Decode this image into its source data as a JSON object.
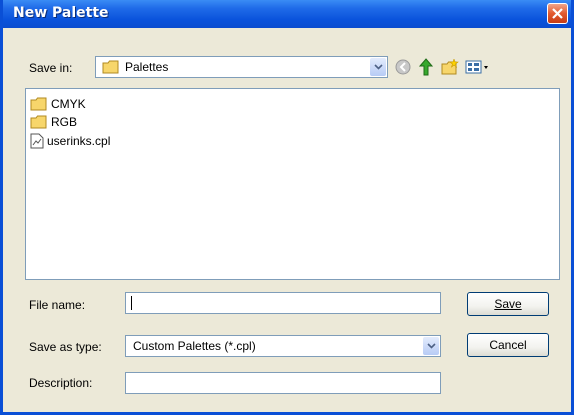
{
  "window": {
    "title": "New Palette"
  },
  "toolbar": {
    "save_in_label": "Save in:",
    "save_in_value": "Palettes",
    "icons": [
      "back-icon",
      "up-folder-icon",
      "new-folder-icon",
      "views-menu-icon"
    ]
  },
  "files": [
    {
      "name": "CMYK",
      "icon": "folder-icon"
    },
    {
      "name": "RGB",
      "icon": "folder-icon"
    },
    {
      "name": "userinks.cpl",
      "icon": "palette-file-icon"
    }
  ],
  "form": {
    "file_name_label": "File name:",
    "file_name_value": "",
    "save_type_label": "Save as type:",
    "save_type_value": "Custom Palettes (*.cpl)",
    "description_label": "Description:",
    "description_value": ""
  },
  "buttons": {
    "save": "Save",
    "cancel": "Cancel"
  },
  "colors": {
    "titlebar": "#0a53dc",
    "face": "#ece9d8",
    "close": "#e35a2e"
  }
}
